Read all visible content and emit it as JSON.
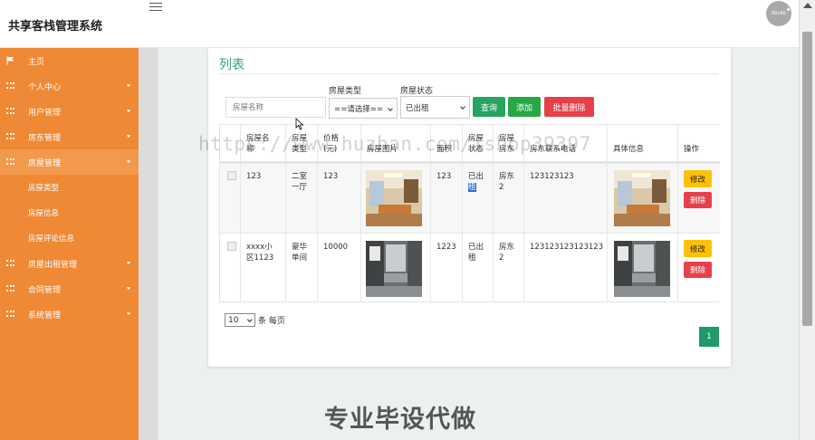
{
  "app": {
    "title": "共享客栈管理系统"
  },
  "avatar": {
    "text": "80x80"
  },
  "sidebar": {
    "items": [
      {
        "label": "主页",
        "icon": "flag-icon"
      },
      {
        "label": "个人中心",
        "icon": "grid-icon"
      },
      {
        "label": "用户管理",
        "icon": "grid-icon"
      },
      {
        "label": "房东管理",
        "icon": "grid-icon"
      },
      {
        "label": "房屋管理",
        "icon": "grid-icon"
      },
      {
        "label": "房屋出租管理",
        "icon": "grid-icon"
      },
      {
        "label": "合同管理",
        "icon": "grid-icon"
      },
      {
        "label": "系统管理",
        "icon": "grid-icon"
      }
    ],
    "sub_items": [
      "房屋类型",
      "房屋信息",
      "房屋评论信息"
    ]
  },
  "card": {
    "title": "列表"
  },
  "filters": {
    "name_placeholder": "房屋名称",
    "type_label": "房屋类型",
    "type_value": "==请选择==",
    "status_label": "房屋状态",
    "status_value": "已出租"
  },
  "buttons": {
    "search": "查询",
    "add": "添加",
    "bulk_delete": "批量删除"
  },
  "table": {
    "headers": {
      "name": [
        "房屋名",
        "称"
      ],
      "type": [
        "房屋",
        "类型"
      ],
      "price": [
        "价格",
        "(元)"
      ],
      "image": "房屋图片",
      "area": "面积",
      "status": [
        "房屋",
        "状态"
      ],
      "owner": [
        "房屋",
        "房东"
      ],
      "phone": "房东联系电话",
      "detail": "具体信息",
      "ops": "操作"
    },
    "rows": [
      {
        "name": [
          "123"
        ],
        "type": [
          "二室",
          "一厅"
        ],
        "price": "123",
        "area": "123",
        "status": [
          "已出",
          "租"
        ],
        "owner": [
          "房东",
          "2"
        ],
        "phone": "123123123"
      },
      {
        "name": [
          "xxxx小",
          "区1123"
        ],
        "type": [
          "豪华",
          "单间"
        ],
        "price": "10000",
        "area": "1223",
        "status": [
          "已出",
          "租"
        ],
        "owner": [
          "房东",
          "2"
        ],
        "phone": "123123123123123"
      }
    ],
    "edit_label": "修改",
    "delete_label": "删除"
  },
  "pagination": {
    "page_size": "10",
    "per_page_label": "条 每页",
    "current": "1"
  },
  "watermark": "https://www.huzhan.com/ishop39397",
  "promo": "专业毕设代做"
}
